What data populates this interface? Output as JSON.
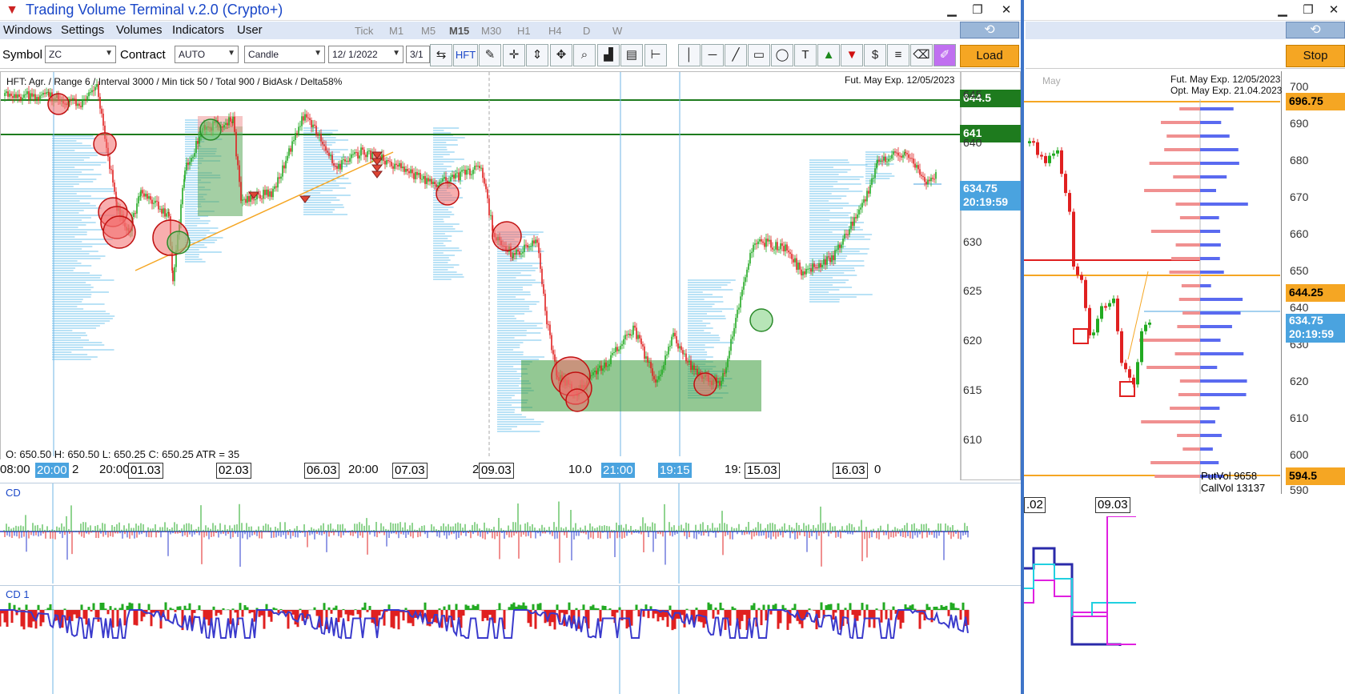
{
  "app": {
    "title": "Trading Volume Terminal v.2.0 (Crypto+)",
    "logo_icon": "terminal-logo-icon"
  },
  "menu": [
    "Windows",
    "Settings",
    "Volumes",
    "Indicators",
    "User"
  ],
  "timeframes": [
    "Tick",
    "M1",
    "M5",
    "M15",
    "M30",
    "H1",
    "H4",
    "D",
    "W"
  ],
  "selected_timeframe": "M15",
  "toolbar": {
    "symbol_label": "Symbol",
    "symbol_value": "ZC",
    "contract_label": "Contract",
    "contract_value": "AUTO",
    "chart_type": "Candle",
    "date_from": "12/ 1/2022",
    "date_to": "3/1",
    "hft_label": "HFT",
    "load_label": "Load",
    "stop_label": "Stop"
  },
  "main_chart": {
    "info_line": "HFT: Agr. / Range 6 / Interval 3000 / Min tick 50 / Total 900 / BidAsk / Delta58%",
    "expiry": "Fut. May Exp. 12/05/2023",
    "ohlc": "O: 650.50  H: 650.50  L: 650.25  C: 650.25  ATR = 35",
    "level_1": "644.5",
    "level_2": "641",
    "price_current": "634.75",
    "time_current": "20:19:59",
    "y_ticks": [
      "645",
      "640",
      "630",
      "625",
      "620",
      "615",
      "610"
    ],
    "x_labels": [
      "08:00",
      "2",
      "20:00",
      "01.03",
      "02.03",
      "06.03",
      "20:00",
      "07.03",
      "2",
      "09.03",
      "10.0",
      "19:",
      "15.03",
      "16.03",
      "0"
    ],
    "x_highlight_1": "20:00",
    "x_highlight_2": "21:00",
    "x_highlight_3": "19:15"
  },
  "indicators": {
    "cd_label": "CD",
    "cd1_label": "CD 1"
  },
  "side_chart": {
    "expiry_fut": "Fut. May Exp. 12/05/2023",
    "expiry_opt": "Opt. May Exp. 21.04.2023",
    "month": "May",
    "y_ticks": [
      "700",
      "690",
      "680",
      "670",
      "660",
      "650",
      "640",
      "630",
      "620",
      "610",
      "600",
      "590"
    ],
    "level_top": "696.75",
    "level_mid": "644.25",
    "price_current": "634.75",
    "time_current": "20:19:59",
    "level_bottom": "594.5",
    "put_vol": "PutVol  9658",
    "call_vol": "CallVol  13137",
    "x_label_1": ".02",
    "x_label_2": "09.03"
  },
  "colors": {
    "accent_blue": "#1a47c8",
    "level_green": "#1e7b1e",
    "price_blue": "#4aa3df",
    "orange": "#f5a623",
    "bull": "#22aa22",
    "bear": "#e02020"
  }
}
